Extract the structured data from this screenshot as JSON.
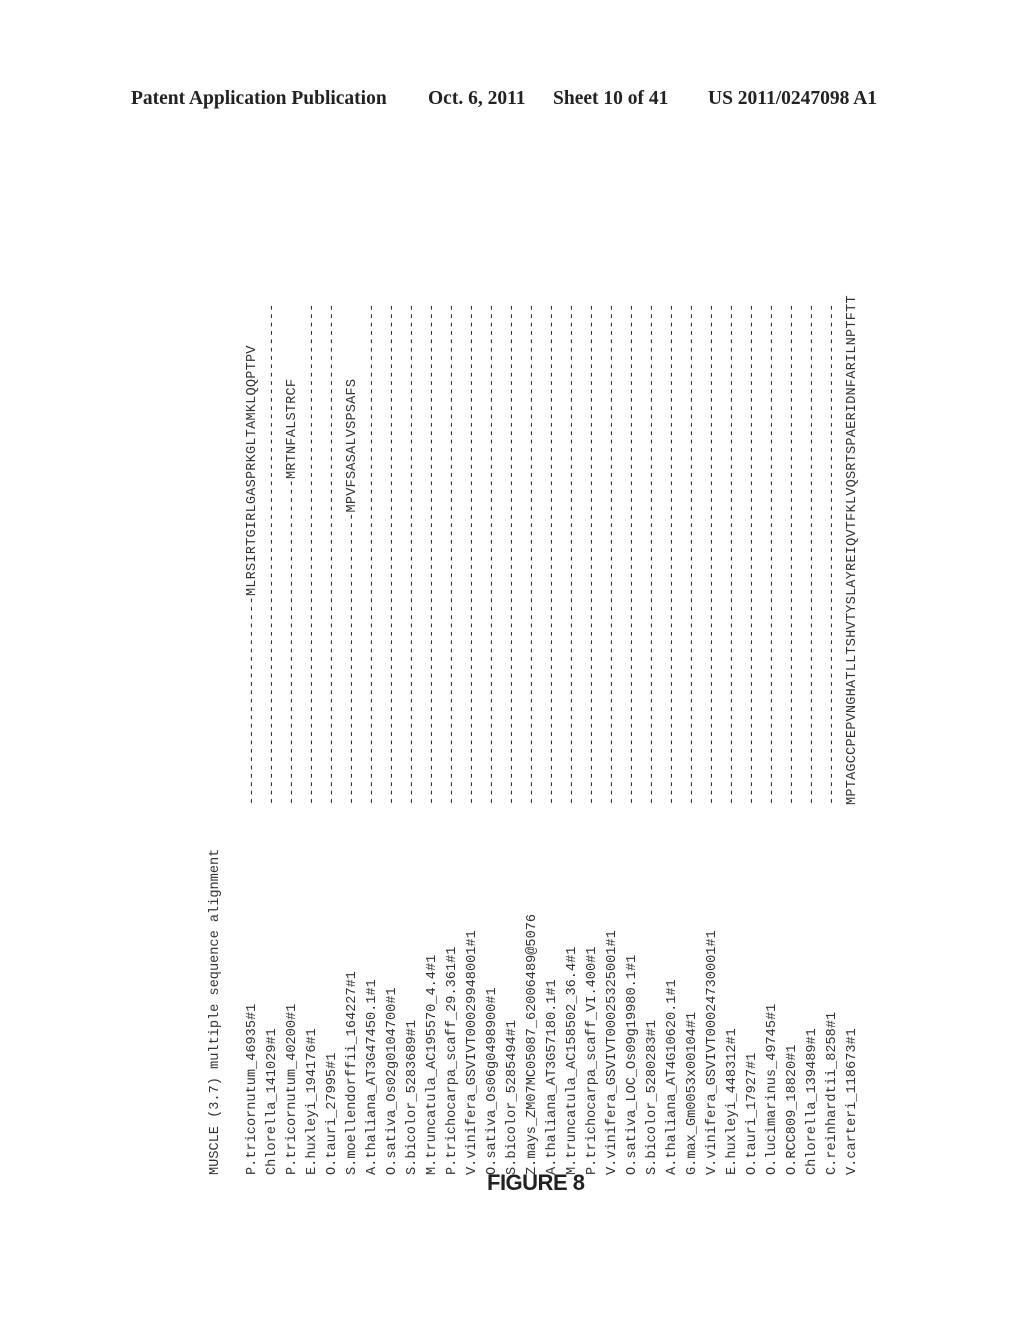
{
  "header": {
    "publication": "Patent Application Publication",
    "date": "Oct. 6, 2011",
    "sheet": "Sheet 10 of 41",
    "number": "US 2011/0247098 A1"
  },
  "alignment": {
    "title": "MUSCLE (3.7) multiple sequence alignment",
    "orientation": "rotated 90 degrees counter-clockwise",
    "rows": [
      {
        "name": "P.tricornutum_46935#1",
        "seq": "-------------------------MLRSIRTGIRLGASPRKGLTAMKLQQPTPV"
      },
      {
        "name": "Chlorella_141029#1",
        "seq": "------------------------------------------------------------"
      },
      {
        "name": "P.tricornutum_40200#1",
        "seq": "---------------------------------------MRTNFALSTRCF"
      },
      {
        "name": "E.huxleyi_194176#1",
        "seq": "------------------------------------------------------------"
      },
      {
        "name": "O.tauri_27995#1",
        "seq": "------------------------------------------------------------"
      },
      {
        "name": "S.moellendorffii_164227#1",
        "seq": "-----------------------------------MPVFSASALVSPSAFS"
      },
      {
        "name": "A.thaliana_AT3G47450.1#1",
        "seq": "------------------------------------------------------------"
      },
      {
        "name": "O.sativa_Os02g0104700#1",
        "seq": "------------------------------------------------------------"
      },
      {
        "name": "S.bicolor_5283689#1",
        "seq": "------------------------------------------------------------"
      },
      {
        "name": "M.truncatula_AC195570_4.4#1",
        "seq": "------------------------------------------------------------"
      },
      {
        "name": "P.trichocarpa_scaff_29.361#1",
        "seq": "------------------------------------------------------------"
      },
      {
        "name": "V.vinifera_GSVIVT00029948001#1",
        "seq": "------------------------------------------------------------"
      },
      {
        "name": "O.sativa_Os06g0498900#1",
        "seq": "------------------------------------------------------------"
      },
      {
        "name": "S.bicolor_5285494#1",
        "seq": "------------------------------------------------------------"
      },
      {
        "name": "Z.mays_ZM07MC05087_62006489@5076",
        "seq": "------------------------------------------------------------"
      },
      {
        "name": "A.thaliana_AT3G57180.1#1",
        "seq": "------------------------------------------------------------"
      },
      {
        "name": "M.truncatula_AC158502_36.4#1",
        "seq": "------------------------------------------------------------"
      },
      {
        "name": "P.trichocarpa_scaff_VI.400#1",
        "seq": "------------------------------------------------------------"
      },
      {
        "name": "V.vinifera_GSVIVT00025325001#1",
        "seq": "------------------------------------------------------------"
      },
      {
        "name": "O.sativa_LOC_Os09g19980.1#1",
        "seq": "------------------------------------------------------------"
      },
      {
        "name": "S.bicolor_5280283#1",
        "seq": "------------------------------------------------------------"
      },
      {
        "name": "A.thaliana_AT4G10620.1#1",
        "seq": "------------------------------------------------------------"
      },
      {
        "name": "G.max_Gm0053x00104#1",
        "seq": "------------------------------------------------------------"
      },
      {
        "name": "V.vinifera_GSVIVT00024730001#1",
        "seq": "------------------------------------------------------------"
      },
      {
        "name": "E.huxleyi_448312#1",
        "seq": "------------------------------------------------------------"
      },
      {
        "name": "O.tauri_17927#1",
        "seq": "------------------------------------------------------------"
      },
      {
        "name": "O.lucimarinus_49745#1",
        "seq": "------------------------------------------------------------"
      },
      {
        "name": "O.RCC809_18820#1",
        "seq": "------------------------------------------------------------"
      },
      {
        "name": "Chlorella_139489#1",
        "seq": "------------------------------------------------------------"
      },
      {
        "name": "C.reinhardtii_8258#1",
        "seq": "------------------------------------------------------------"
      },
      {
        "name": "V.carteri_118673#1",
        "seq": "MPTAGCCPEPVNGHATLLTSHVTYSLAYREIQVTFKLVQSRTSPAERIDNFARILNPTFTT"
      }
    ]
  },
  "figure_label": "FIGURE 8"
}
